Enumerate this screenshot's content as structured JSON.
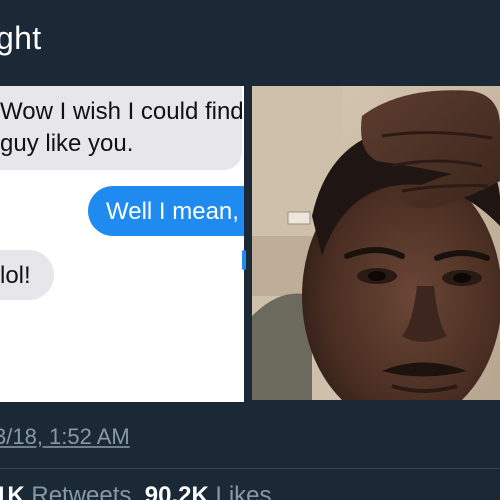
{
  "header": {
    "title": "ght"
  },
  "messages": {
    "received_line1": "Wow I wish I could find",
    "received_line2": "guy like you.",
    "sent": "Well I mean,",
    "received_short": "lol!"
  },
  "tweet": {
    "timestamp": "3/18, 1:52 AM",
    "retweets_count": "1K",
    "retweets_label": "Retweets",
    "likes_count": "90.2K",
    "likes_label": "Likes"
  },
  "colors": {
    "background": "#1b2836",
    "sent_bubble": "#1f8bf0",
    "received_bubble": "#e6e6eb",
    "meta_text": "#8899a6"
  }
}
